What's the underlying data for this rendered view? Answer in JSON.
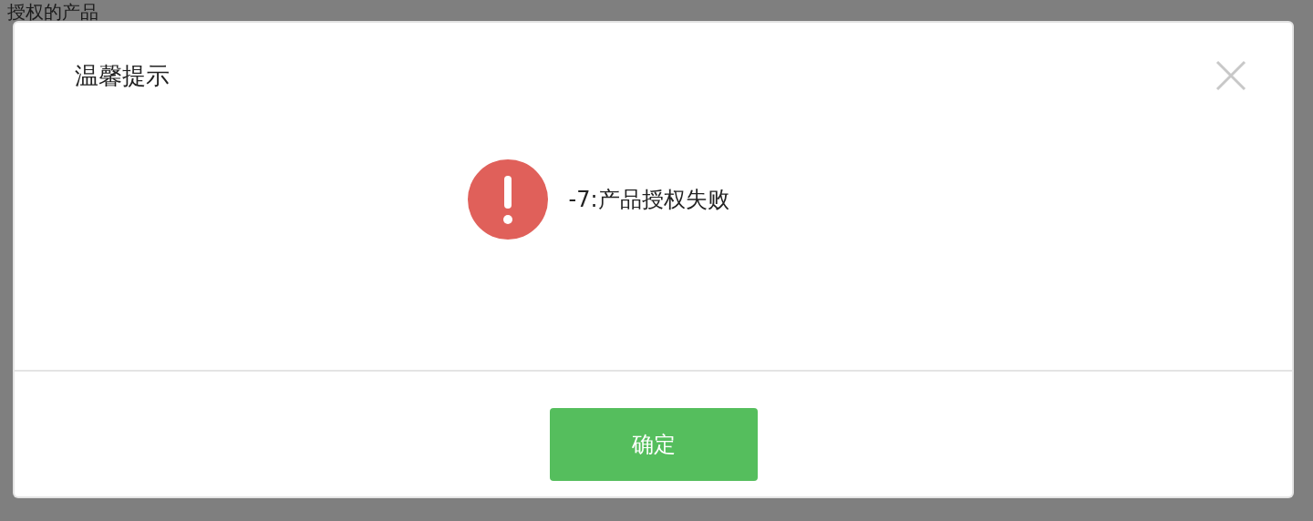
{
  "page": {
    "title": "授权的产品"
  },
  "dialog": {
    "title": "温馨提示",
    "kind": "error",
    "message": "-7:产品授权失败",
    "buttons": [
      {
        "label": "确定"
      }
    ]
  }
}
